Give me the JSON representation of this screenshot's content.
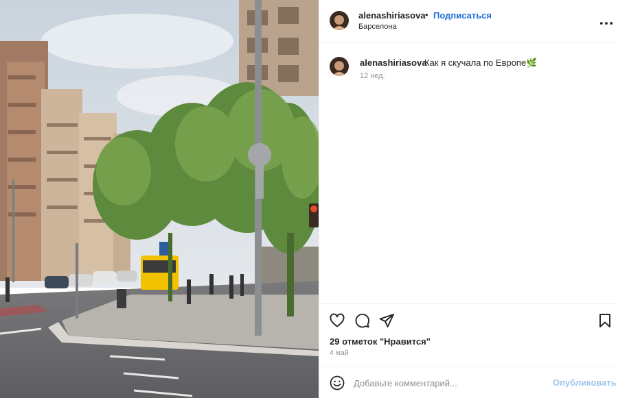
{
  "post": {
    "username": "alenashiriasova",
    "separator": "•",
    "follow_label": "Подписаться",
    "location": "Барселона",
    "more_icon": "more-horizontal-icon"
  },
  "caption": {
    "username": "alenashiriasova",
    "text": "Как я скучала по Европе🌿",
    "time": "12 нед."
  },
  "actions": {
    "like_icon": "heart-icon",
    "comment_icon": "comment-bubble-icon",
    "share_icon": "paper-plane-icon",
    "save_icon": "bookmark-icon"
  },
  "likes_text": "29 отметок \"Нравится\"",
  "date_text": "4 май",
  "add_comment": {
    "emoji_icon": "smiley-icon",
    "placeholder": "Добавьте комментарий...",
    "publish_label": "Опубликовать"
  },
  "colors": {
    "follow": "#1d6fd6",
    "publish_disabled": "#9fc6ea",
    "text": "#262626",
    "muted": "#8e8e8e",
    "divider": "#efefef"
  }
}
